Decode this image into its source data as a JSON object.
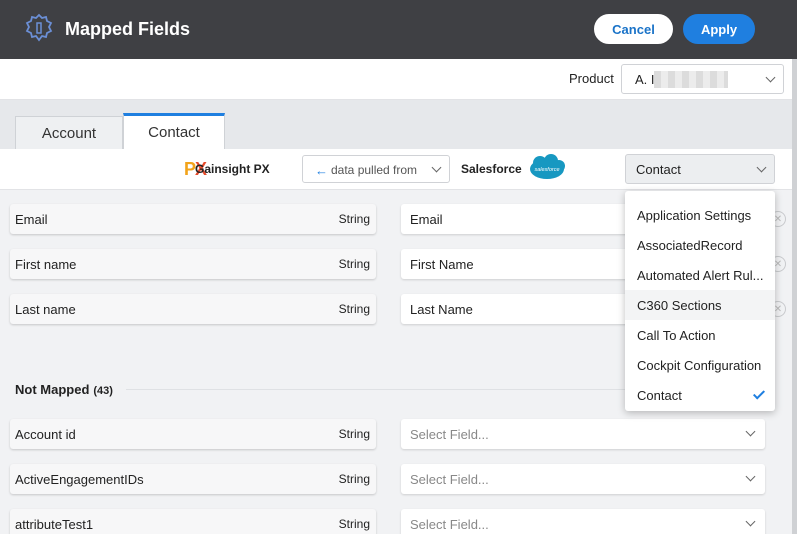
{
  "header": {
    "title": "Mapped Fields",
    "cancel_label": "Cancel",
    "apply_label": "Apply",
    "accent": "#1f7fe0"
  },
  "product": {
    "label": "Product",
    "value": "A. I"
  },
  "tabs": [
    {
      "label": "Account",
      "active": false
    },
    {
      "label": "Contact",
      "active": true
    }
  ],
  "source_bar": {
    "source_logo": "PX",
    "source_name": "Gainsight PX",
    "direction": "data pulled from",
    "target_name": "Salesforce",
    "target_logo_text": "salesforce",
    "object_value": "Contact"
  },
  "mapped_fields": [
    {
      "name": "Email",
      "type": "String",
      "mapped_to": "Email"
    },
    {
      "name": "First name",
      "type": "String",
      "mapped_to": "First Name"
    },
    {
      "name": "Last name",
      "type": "String",
      "mapped_to": "Last Name"
    }
  ],
  "not_mapped": {
    "title": "Not Mapped",
    "count": "(43)",
    "placeholder": "Select Field...",
    "fields": [
      {
        "name": "Account id",
        "type": "String"
      },
      {
        "name": "ActiveEngagementIDs",
        "type": "String"
      },
      {
        "name": "attributeTest1",
        "type": "String"
      }
    ]
  },
  "object_dropdown": {
    "items": [
      {
        "label": "Application Settings"
      },
      {
        "label": "AssociatedRecord"
      },
      {
        "label": "Automated Alert Rul..."
      },
      {
        "label": "C360 Sections"
      },
      {
        "label": "Call To Action"
      },
      {
        "label": "Cockpit Configuration"
      },
      {
        "label": "Contact"
      }
    ],
    "selected": "Contact",
    "hovered": "C360 Sections"
  }
}
